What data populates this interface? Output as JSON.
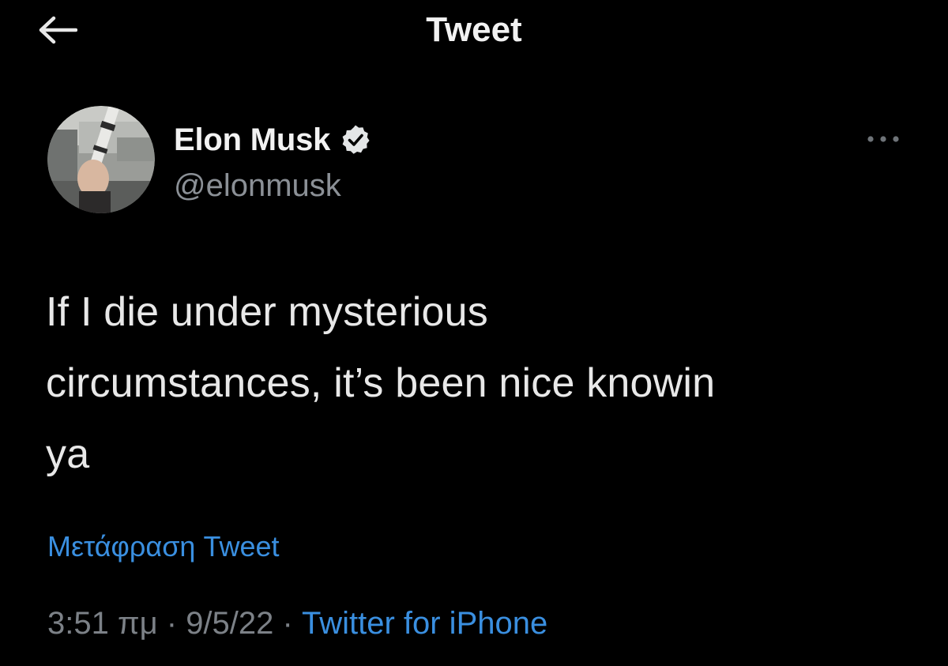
{
  "header": {
    "title": "Tweet",
    "back_icon": "arrow-left-icon"
  },
  "author": {
    "name": "Elon Musk",
    "handle": "@elonmusk",
    "verified_icon": "verified-badge-icon",
    "more_icon": "ellipsis-icon"
  },
  "tweet": {
    "text": "If I die under mysterious\ncircumstances, it’s been nice knowin\nya",
    "translate_label": "Μετάφραση Tweet",
    "time": "3:51 πμ",
    "separator": "·",
    "date": "9/5/22",
    "source": "Twitter for iPhone"
  },
  "colors": {
    "background": "#000000",
    "primary_text": "#e7e9ea",
    "secondary_text": "#7c8187",
    "link": "#3a8fe0"
  }
}
